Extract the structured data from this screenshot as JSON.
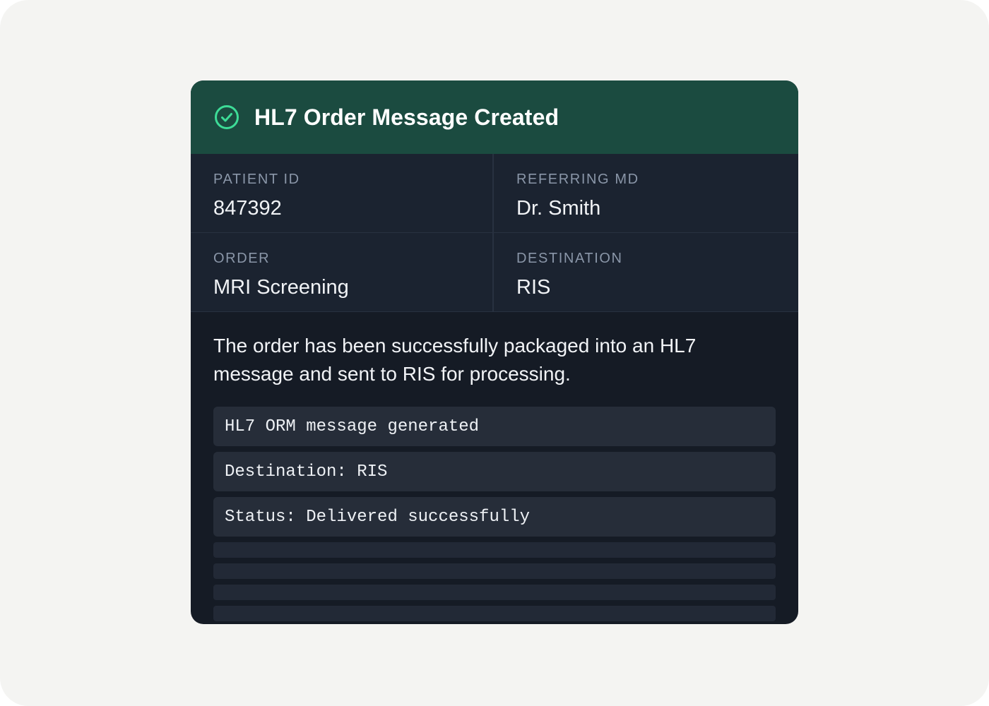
{
  "card": {
    "title": "HL7 Order Message Created",
    "header_color": "#1b4b40",
    "success_color": "#3ddc97",
    "fields": [
      {
        "label": "PATIENT ID",
        "value": "847392"
      },
      {
        "label": "REFERRING MD",
        "value": "Dr. Smith"
      },
      {
        "label": "ORDER",
        "value": "MRI Screening"
      },
      {
        "label": "DESTINATION",
        "value": "RIS"
      }
    ],
    "description": "The order has been successfully packaged into an HL7 message and sent to RIS for processing.",
    "log_lines": [
      "HL7 ORM message generated",
      "Destination: RIS",
      "Status: Delivered successfully"
    ],
    "header_icon": "check-circle-icon"
  }
}
